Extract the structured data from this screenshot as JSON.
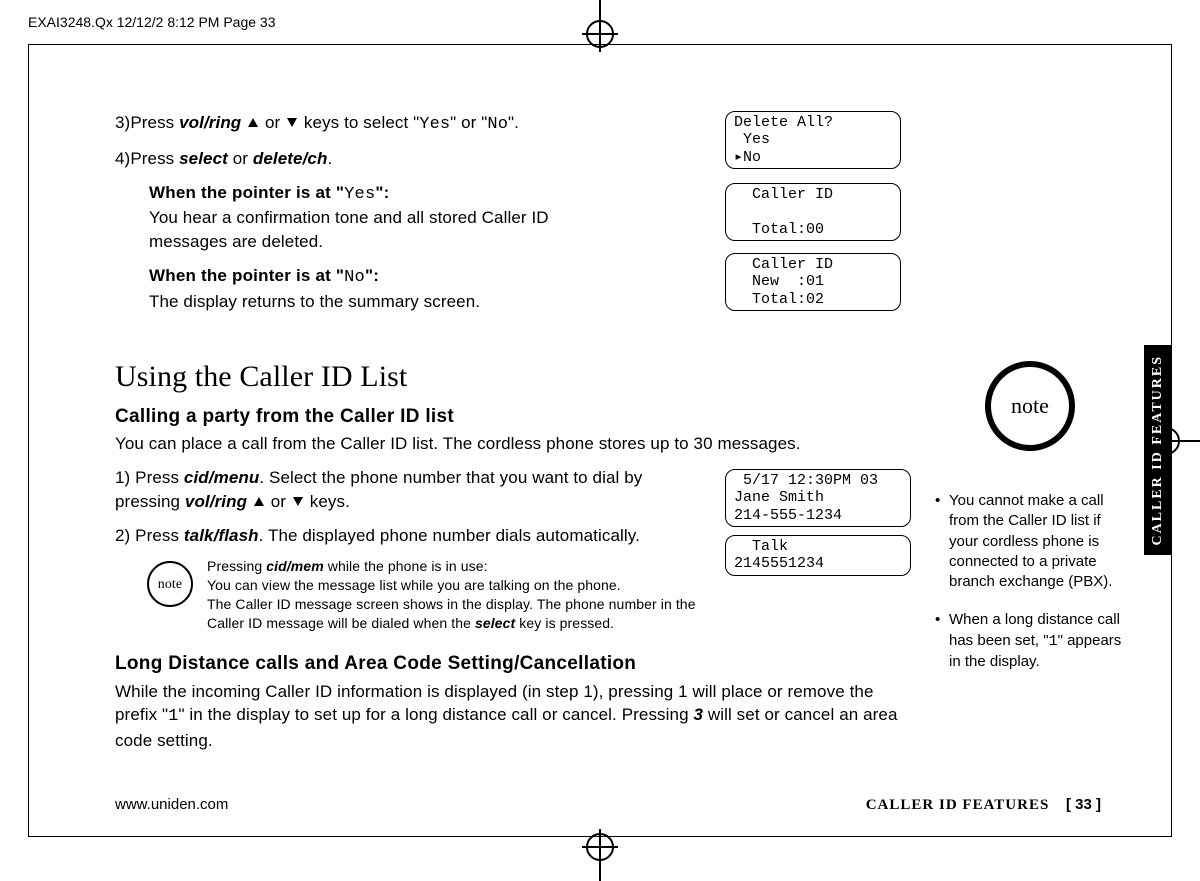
{
  "runhead": "EXAI3248.Qx  12/12/2  8:12 PM  Page 33",
  "tab": "CALLER ID FEATURES",
  "steps34": {
    "s3a": "3)Press ",
    "s3_volring": "vol/ring",
    "s3b": " or ",
    "s3c": " keys to select \"",
    "s3_yes": "Yes",
    "s3d": "\" or \"",
    "s3_no": "No",
    "s3e": "\".",
    "s4a": "4)Press ",
    "s4_select": "select",
    "s4b": " or ",
    "s4_delete": "delete/ch",
    "s4c": "."
  },
  "when_yes_head_a": "When the pointer is at \"",
  "when_yes_lcd": "Yes",
  "when_yes_head_b": "\":",
  "when_yes_body": "You hear a confirmation tone and all stored Caller ID messages are deleted.",
  "when_no_head_a": "When the pointer is at \"",
  "when_no_lcd": "No",
  "when_no_head_b": "\":",
  "when_no_body": "The display returns to the summary screen.",
  "h1": "Using the Caller ID List",
  "h2a": "Calling a party from the Caller ID list",
  "p_intro": "You can place a call from the Caller ID list. The cordless phone stores up to 30 messages.",
  "s1a": "1) Press ",
  "s1_cid": "cid/menu",
  "s1b": ". Select the phone number that you want to dial by pressing ",
  "s1_volring": "vol/ring",
  "s1c": " or ",
  "s1d": " keys.",
  "s2a": "2) Press ",
  "s2_talk": "talk/flash",
  "s2b": ". The displayed phone number dials automatically.",
  "inline_note": {
    "label": "note",
    "l1a": "Pressing ",
    "l1_cid": "cid/mem",
    "l1b": " while the phone is in use:",
    "l2": "You can view the message list while you are talking on the phone.",
    "l3a": "The Caller ID message screen shows in the display. The phone number in the Caller ID message will be dialed when the ",
    "l3_sel": "select",
    "l3b": " key is pressed."
  },
  "h2b": "Long Distance calls and Area Code Setting/Cancellation",
  "p_long_a": "While the incoming Caller ID information is displayed (in step 1), pressing 1 will place or remove the prefix \"",
  "p_long_one": "1",
  "p_long_b": "\" in the display to set up for a long distance call or cancel. Pressing ",
  "p_long_three": "3",
  "p_long_c": " will set or cancel an area code setting.",
  "lcd": {
    "box1": "Delete All?\n Yes\n▸No",
    "box2": "  Caller ID\n\n  Total:00",
    "box3": "  Caller ID\n  New  :01\n  Total:02",
    "box4": " 5/17 12:30PM 03\nJane Smith\n214-555-1234",
    "box5": "  Talk\n2145551234"
  },
  "side": {
    "note_label": "note",
    "b1a": "You cannot make a call from the Caller ID list if your cordless phone is connected to a private branch exchange (PBX).",
    "b2a": "When a long distance call has been set, \"",
    "b2_one": "1",
    "b2b": "\" appears in the display."
  },
  "footer": {
    "url": "www.uniden.com",
    "section": "CALLER ID FEATURES",
    "page": "[ 33 ]"
  }
}
